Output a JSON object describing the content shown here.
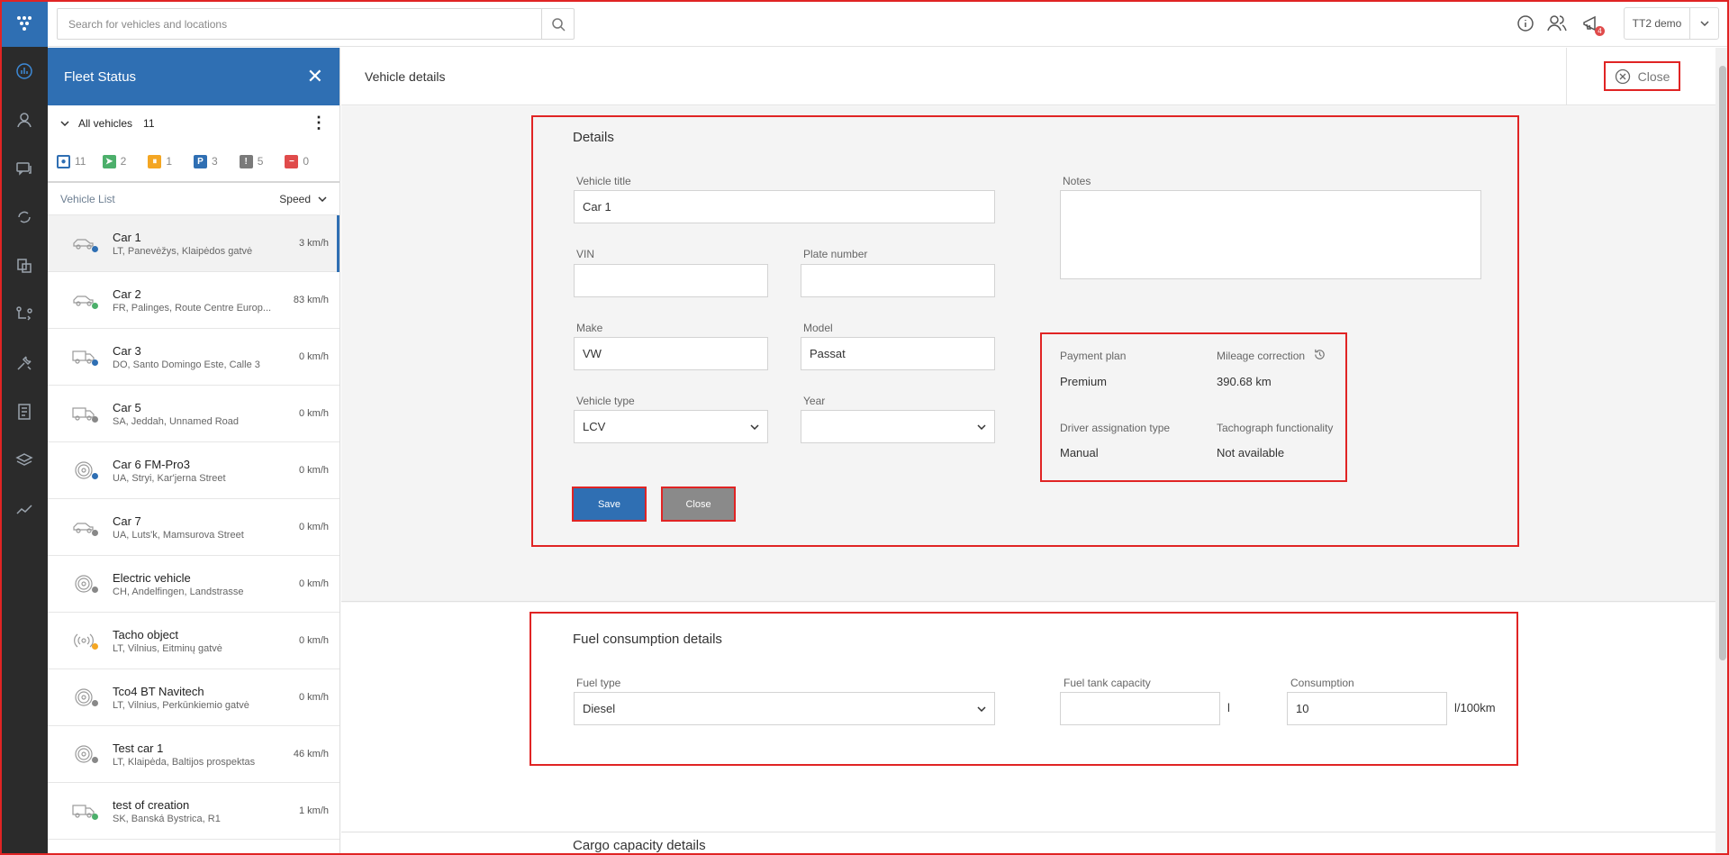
{
  "search": {
    "placeholder": "Search for vehicles and locations"
  },
  "topbar": {
    "notifications_count": "4",
    "user_name": "TT2 demo"
  },
  "fleet": {
    "title": "Fleet Status",
    "group_label": "All vehicles",
    "group_count": "11",
    "filters": [
      {
        "icon": "all-vehicles-icon",
        "count": "11",
        "color": "#2f6fb3",
        "glyph": "●"
      },
      {
        "icon": "moving-icon",
        "count": "2",
        "color": "#4caf6b",
        "glyph": "➤"
      },
      {
        "icon": "idle-icon",
        "count": "1",
        "color": "#f4a623",
        "glyph": "⏸"
      },
      {
        "icon": "parked-icon",
        "count": "3",
        "color": "#2f6fb3",
        "glyph": "P"
      },
      {
        "icon": "alert-icon",
        "count": "5",
        "color": "#7a7a7a",
        "glyph": "!"
      },
      {
        "icon": "offline-icon",
        "count": "0",
        "color": "#e04b4b",
        "glyph": "−"
      }
    ],
    "list_header": "Vehicle List",
    "sort_label": "Speed",
    "vehicles": [
      {
        "name": "Car 1",
        "address": "LT, Panevėžys, Klaipėdos gatvė",
        "speed": "3 km/h",
        "icon": "car-icon",
        "status_color": "#2f6fb3"
      },
      {
        "name": "Car 2",
        "address": "FR, Palinges, Route Centre Europ...",
        "speed": "83 km/h",
        "icon": "car-icon",
        "status_color": "#4caf6b"
      },
      {
        "name": "Car 3",
        "address": "DO, Santo Domingo Este, Calle 3",
        "speed": "0 km/h",
        "icon": "truck-icon",
        "status_color": "#2f6fb3"
      },
      {
        "name": "Car 5",
        "address": "SA, Jeddah, Unnamed Road",
        "speed": "0 km/h",
        "icon": "truck-icon",
        "status_color": "#888888"
      },
      {
        "name": "Car 6 FM-Pro3",
        "address": "UA, Stryi, Kar'jerna Street",
        "speed": "0 km/h",
        "icon": "steering-wheel-icon",
        "status_color": "#2f6fb3"
      },
      {
        "name": "Car 7",
        "address": "UA, Luts'k, Mamsurova Street",
        "speed": "0 km/h",
        "icon": "car-icon",
        "status_color": "#888888"
      },
      {
        "name": "Electric vehicle",
        "address": "CH, Andelfingen, Landstrasse",
        "speed": "0 km/h",
        "icon": "steering-wheel-icon",
        "status_color": "#888888"
      },
      {
        "name": "Tacho object",
        "address": "LT, Vilnius, Eitminų gatvė",
        "speed": "0 km/h",
        "icon": "broadcast-icon",
        "status_color": "#f4a623"
      },
      {
        "name": "Tco4 BT Navitech",
        "address": "LT, Vilnius, Perkūnkiemio gatvė",
        "speed": "0 km/h",
        "icon": "steering-wheel-icon",
        "status_color": "#888888"
      },
      {
        "name": "Test car 1",
        "address": "LT, Klaipėda, Baltijos prospektas",
        "speed": "46 km/h",
        "icon": "steering-wheel-icon",
        "status_color": "#888888"
      },
      {
        "name": "test of creation",
        "address": "SK, Banská Bystrica, R1",
        "speed": "1 km/h",
        "icon": "truck-icon",
        "status_color": "#4caf6b"
      }
    ]
  },
  "main": {
    "title": "Vehicle details",
    "close_label": "Close",
    "details": {
      "title": "Details",
      "vehicle_title_label": "Vehicle title",
      "vehicle_title_value": "Car 1",
      "vin_label": "VIN",
      "vin_value": "",
      "plate_label": "Plate number",
      "plate_value": "",
      "make_label": "Make",
      "make_value": "VW",
      "model_label": "Model",
      "model_value": "Passat",
      "vehicle_type_label": "Vehicle type",
      "vehicle_type_value": "LCV",
      "year_label": "Year",
      "year_value": "",
      "notes_label": "Notes",
      "payment_plan_label": "Payment plan",
      "payment_plan_value": "Premium",
      "mileage_label": "Mileage correction",
      "mileage_value": "390.68 km",
      "driver_assign_label": "Driver assignation type",
      "driver_assign_value": "Manual",
      "tacho_label": "Tachograph functionality",
      "tacho_value": "Not available",
      "save_label": "Save",
      "close_label": "Close"
    },
    "fuel": {
      "title": "Fuel consumption details",
      "fuel_type_label": "Fuel type",
      "fuel_type_value": "Diesel",
      "tank_label": "Fuel tank capacity",
      "tank_value": "",
      "tank_unit": "l",
      "consumption_label": "Consumption",
      "consumption_value": "10",
      "consumption_unit": "l/100km"
    },
    "cargo": {
      "title": "Cargo capacity details"
    }
  },
  "colors": {
    "accent": "#2f6fb3",
    "highlight_border": "#e02424",
    "rail": "#2b2b2b"
  }
}
